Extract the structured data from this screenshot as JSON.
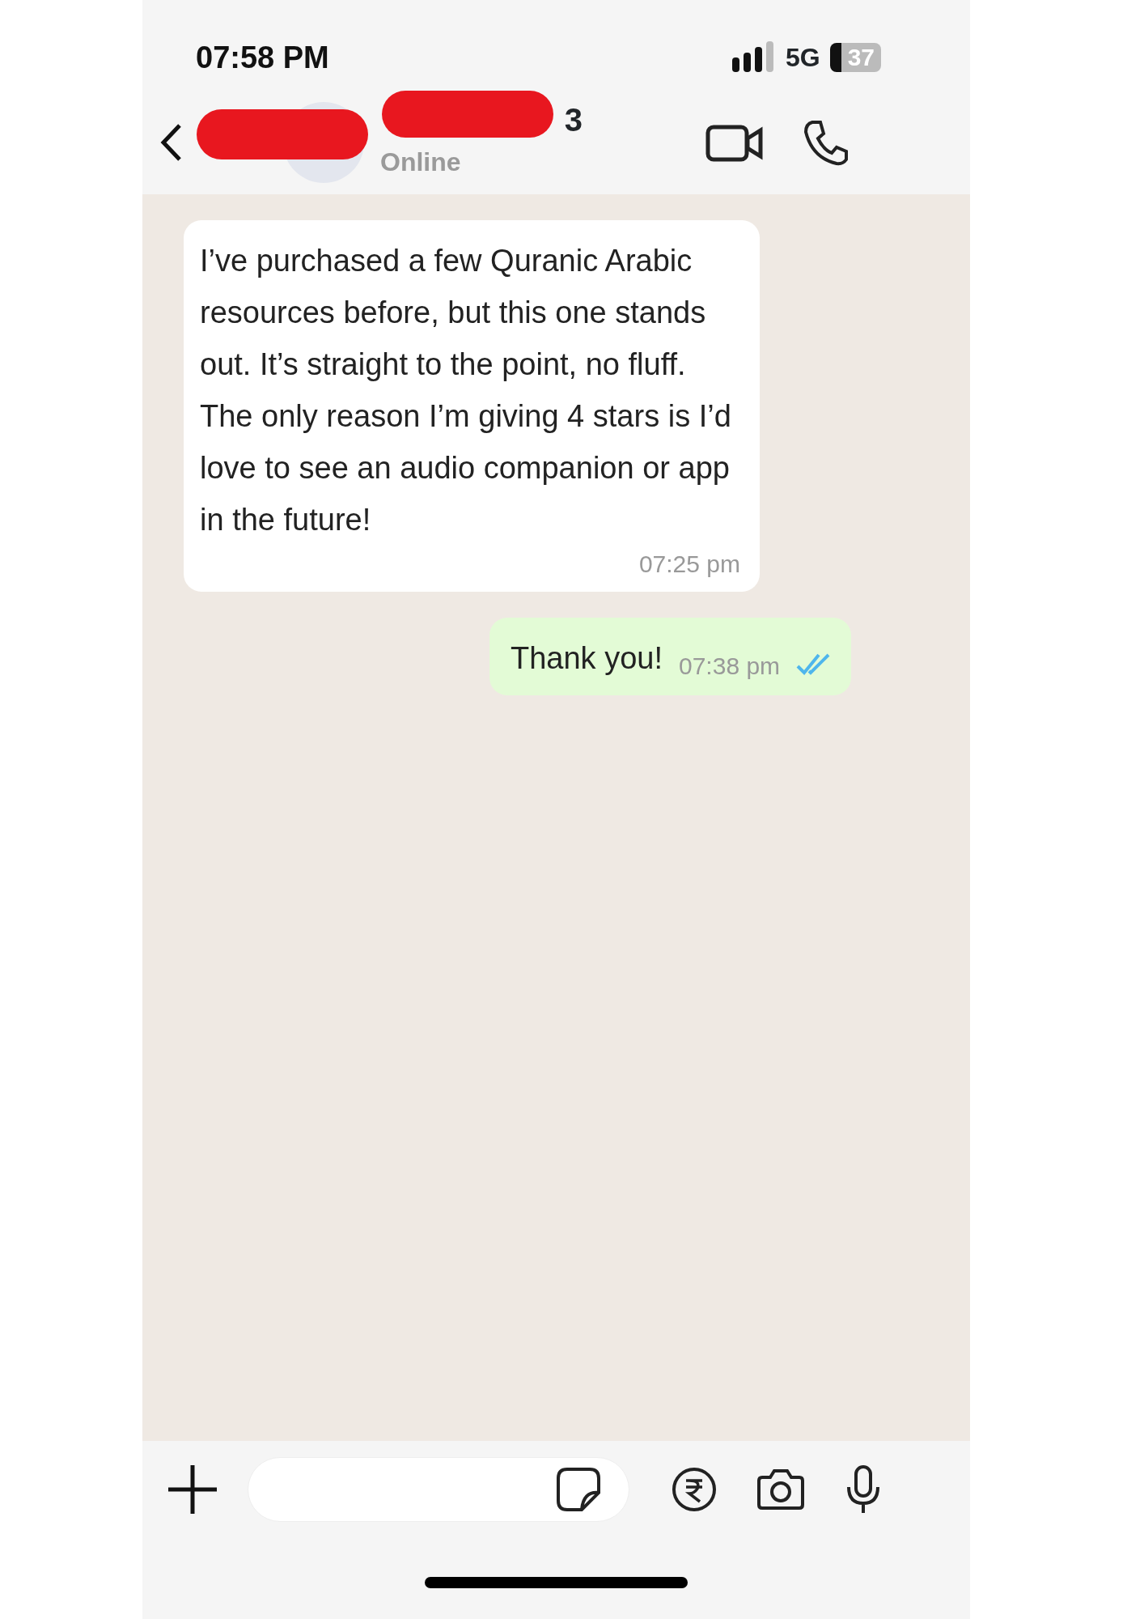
{
  "status_bar": {
    "time": "07:58 PM",
    "network": "5G",
    "battery": "37"
  },
  "header": {
    "name_fragment": "3",
    "status": "Online"
  },
  "messages": [
    {
      "kind": "incoming",
      "text": "I’ve purchased a few Quranic Arabic resources before, but this one stands out. It’s straight to the point, no fluff. The only reason I’m giving 4 stars is I’d love to see an audio companion or app in the future!",
      "time": "07:25 pm"
    },
    {
      "kind": "outgoing",
      "text": "Thank you!",
      "time": "07:38 pm",
      "read": true
    }
  ]
}
